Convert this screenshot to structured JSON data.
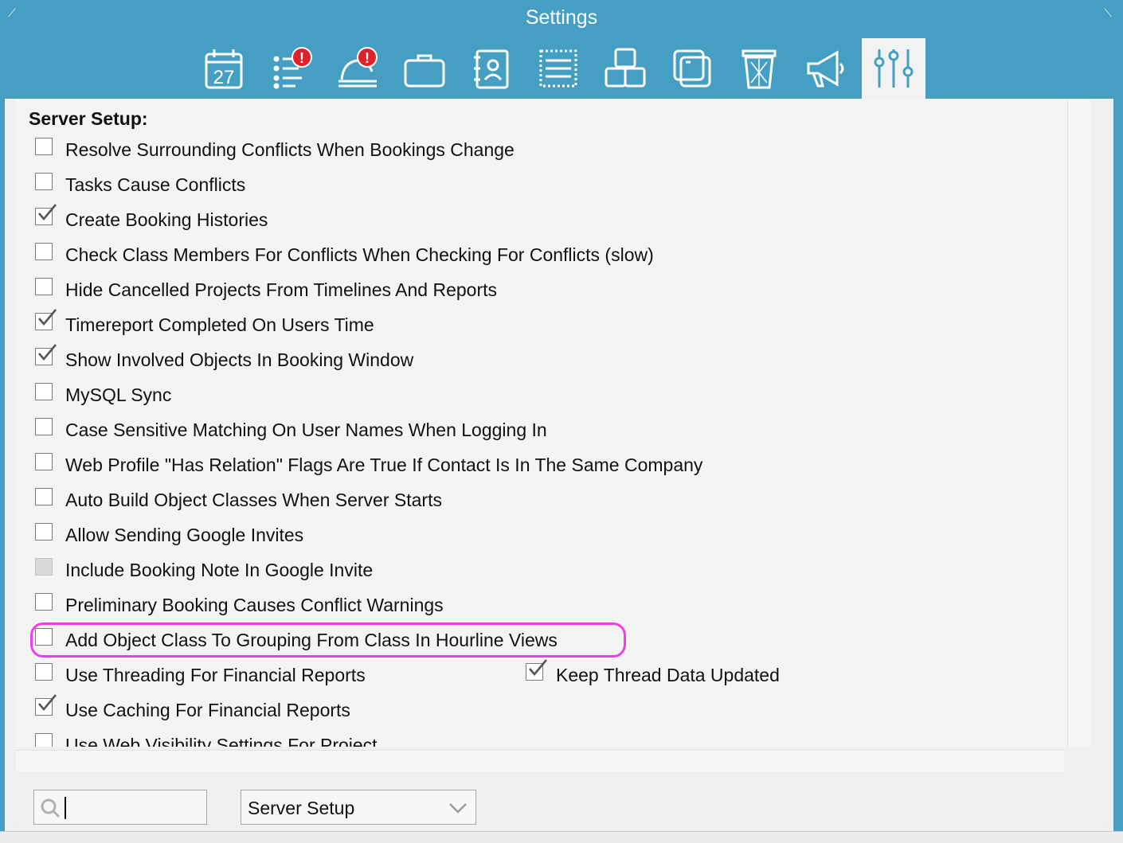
{
  "window": {
    "title": "Settings"
  },
  "toolbar": {
    "icons": [
      {
        "name": "calendar-icon",
        "text": "27"
      },
      {
        "name": "tasks-alert-icon"
      },
      {
        "name": "bell-alert-icon"
      },
      {
        "name": "briefcase-icon"
      },
      {
        "name": "contacts-icon"
      },
      {
        "name": "list-icon"
      },
      {
        "name": "objects-icon"
      },
      {
        "name": "window-icon"
      },
      {
        "name": "trash-icon"
      },
      {
        "name": "megaphone-icon"
      },
      {
        "name": "sliders-icon",
        "active": true
      }
    ],
    "alert_color": "#e0202a"
  },
  "section": {
    "heading": "Server Setup:"
  },
  "options": [
    {
      "label": "Resolve Surrounding Conflicts When Bookings Change",
      "checked": false
    },
    {
      "label": "Tasks Cause Conflicts",
      "checked": false
    },
    {
      "label": "Create Booking Histories",
      "checked": true
    },
    {
      "label": "Check Class Members For Conflicts When Checking For Conflicts (slow)",
      "checked": false
    },
    {
      "label": "Hide Cancelled Projects From Timelines And Reports",
      "checked": false
    },
    {
      "label": "Timereport Completed On Users Time",
      "checked": true
    },
    {
      "label": "Show Involved Objects In Booking Window",
      "checked": true
    },
    {
      "label": "MySQL Sync",
      "checked": false
    },
    {
      "label": "Case Sensitive Matching On User Names When Logging In",
      "checked": false
    },
    {
      "label": "Web Profile \"Has Relation\" Flags Are True If Contact Is In The Same Company",
      "checked": false
    },
    {
      "label": "Auto Build Object Classes When Server Starts",
      "checked": false
    },
    {
      "label": "Allow Sending Google Invites",
      "checked": false
    },
    {
      "label": "Include Booking Note In Google Invite",
      "checked": false,
      "disabled": true
    },
    {
      "label": "Preliminary Booking Causes Conflict Warnings",
      "checked": false
    },
    {
      "label": "Add Object Class To Grouping From Class In Hourline Views",
      "checked": false,
      "highlighted": true
    },
    {
      "label": "Use Threading For Financial Reports",
      "checked": false
    },
    {
      "label": "Use Caching For Financial Reports",
      "checked": true
    },
    {
      "label": "Use Web Visibility Settings For Project",
      "checked": false
    }
  ],
  "side_option": {
    "label": "Keep Thread Data Updated",
    "checked": true
  },
  "footer": {
    "search": {
      "value": "",
      "placeholder": ""
    },
    "section_select": {
      "value": "Server Setup"
    }
  },
  "colors": {
    "titlebar": "#449fc2",
    "highlight": "#ee3ee8"
  }
}
